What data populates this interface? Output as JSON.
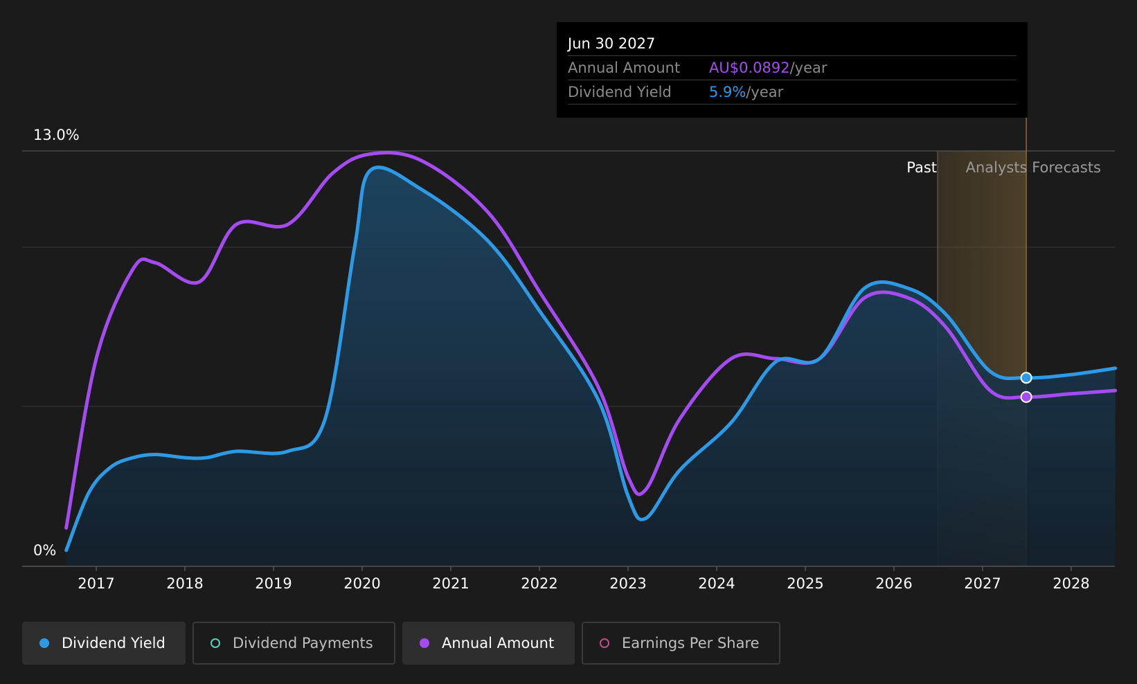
{
  "chart_data": {
    "type": "line",
    "y_axis": {
      "max_label": "13.0%",
      "min_label": "0%",
      "range": [
        0,
        13
      ]
    },
    "x_ticks": [
      "2017",
      "2018",
      "2019",
      "2020",
      "2021",
      "2022",
      "2023",
      "2024",
      "2025",
      "2026",
      "2027",
      "2028"
    ],
    "regions": {
      "past_label": "Past",
      "forecast_label": "Analysts Forecasts"
    },
    "series": [
      {
        "name": "Dividend Yield",
        "color": "#2e9ae6",
        "fill": true,
        "points": [
          [
            "2016-08-30",
            0.5
          ],
          [
            "2016-12-01",
            2.3
          ],
          [
            "2017-03-01",
            3.1
          ],
          [
            "2017-06-01",
            3.4
          ],
          [
            "2017-09-01",
            3.5
          ],
          [
            "2018-01-01",
            3.4
          ],
          [
            "2018-04-01",
            3.4
          ],
          [
            "2018-08-01",
            3.6
          ],
          [
            "2019-03-01",
            3.6
          ],
          [
            "2019-08-01",
            4.6
          ],
          [
            "2019-12-01",
            10.0
          ],
          [
            "2020-02-05",
            12.4
          ],
          [
            "2020-09-01",
            11.8
          ],
          [
            "2021-06-01",
            10.2
          ],
          [
            "2022-01-01",
            8.0
          ],
          [
            "2022-09-01",
            5.2
          ],
          [
            "2023-01-01",
            2.2
          ],
          [
            "2023-03-15",
            1.5
          ],
          [
            "2023-08-01",
            3.0
          ],
          [
            "2024-03-01",
            4.5
          ],
          [
            "2024-09-01",
            6.4
          ],
          [
            "2025-03-01",
            6.5
          ],
          [
            "2025-09-01",
            8.7
          ],
          [
            "2026-03-01",
            8.7
          ],
          [
            "2026-08-01",
            7.9
          ],
          [
            "2027-02-01",
            6.1
          ],
          [
            "2027-06-30",
            5.9
          ],
          [
            "2028-01-01",
            6.0
          ],
          [
            "2028-07-01",
            6.2
          ]
        ]
      },
      {
        "name": "Annual Amount",
        "color": "#a44cf0",
        "fill": false,
        "points": [
          [
            "2016-08-30",
            1.2
          ],
          [
            "2017-01-01",
            6.5
          ],
          [
            "2017-06-01",
            9.3
          ],
          [
            "2017-09-01",
            9.5
          ],
          [
            "2018-03-01",
            8.9
          ],
          [
            "2018-08-01",
            10.7
          ],
          [
            "2019-03-01",
            10.7
          ],
          [
            "2019-09-01",
            12.3
          ],
          [
            "2020-02-01",
            12.9
          ],
          [
            "2020-09-01",
            12.7
          ],
          [
            "2021-06-01",
            11.1
          ],
          [
            "2022-01-01",
            8.6
          ],
          [
            "2022-09-01",
            5.6
          ],
          [
            "2023-01-01",
            2.8
          ],
          [
            "2023-03-15",
            2.4
          ],
          [
            "2023-08-01",
            4.6
          ],
          [
            "2024-03-01",
            6.5
          ],
          [
            "2024-09-01",
            6.5
          ],
          [
            "2025-03-01",
            6.5
          ],
          [
            "2025-09-01",
            8.4
          ],
          [
            "2026-03-01",
            8.4
          ],
          [
            "2026-08-01",
            7.5
          ],
          [
            "2027-02-01",
            5.5
          ],
          [
            "2027-06-30",
            5.3
          ],
          [
            "2028-01-01",
            5.4
          ],
          [
            "2028-07-01",
            5.5
          ]
        ]
      }
    ],
    "highlight_date": "2027-06-30"
  },
  "tooltip": {
    "date": "Jun 30 2027",
    "rows": [
      {
        "name": "Annual Amount",
        "value": "AU$0.0892",
        "suffix": "/year",
        "color": "#a44cf0"
      },
      {
        "name": "Dividend Yield",
        "value": "5.9%",
        "suffix": "/year",
        "color": "#2e9ae6"
      }
    ]
  },
  "legend": [
    {
      "label": "Dividend Yield",
      "active": true,
      "dot": "filled",
      "color": "#2e9ae6"
    },
    {
      "label": "Dividend Payments",
      "active": false,
      "dot": "hollow",
      "color": "#5fd0b8"
    },
    {
      "label": "Annual Amount",
      "active": true,
      "dot": "filled",
      "color": "#a44cf0"
    },
    {
      "label": "Earnings Per Share",
      "active": false,
      "dot": "hollow",
      "color": "#c24b8e"
    }
  ]
}
